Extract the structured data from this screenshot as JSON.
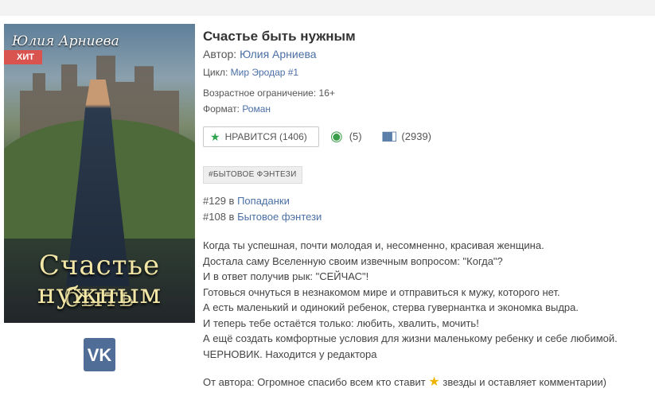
{
  "cover": {
    "author_script": "Юлия Арниева",
    "badge": "ХИТ",
    "title_line1": "Счастье быть",
    "title_line2": "нужным"
  },
  "social": {
    "vk_label": "VK"
  },
  "book": {
    "title": "Счастье быть нужным",
    "author_label": "Автор:",
    "author_name": "Юлия Арниева",
    "cycle_label": "Цикл:",
    "cycle_name": "Мир Эродар #1",
    "age_label": "Возрастное ограничение:",
    "age_value": "16+",
    "format_label": "Формат:",
    "format_value": "Роман"
  },
  "actions": {
    "like_label": "НРАВИТСЯ (1406)",
    "piggy_count": "(5)",
    "library_count": "(2939)"
  },
  "tags": [
    "#БЫТОВОЕ ФЭНТЕЗИ"
  ],
  "ratings": [
    {
      "place": "#129",
      "prep": "в",
      "genre": "Попаданки"
    },
    {
      "place": "#108",
      "prep": "в",
      "genre": "Бытовое фэнтези"
    }
  ],
  "annotation": [
    "Когда ты успешная, почти молодая и, несомненно, красивая женщина.",
    "Достала саму Вселенную своим извечным вопросом: \"Когда\"?",
    "И в ответ получив рык: \"СЕЙЧАС\"!",
    "Готовься очнуться в незнакомом мире и отправиться к мужу, которого нет.",
    "А есть маленький и одинокий ребенок, стерва гувернантка и экономка выдра.",
    "И теперь тебе остаётся только: любить, хвалить, мочить!",
    "А ещё создать комфортные условия для жизни маленькому ребенку и себе любимой.",
    "ЧЕРНОВИК. Находится у редактора"
  ],
  "from_author": {
    "before": "От автора: Огромное спасибо всем кто ставит",
    "after": "звезды и оставляет комментарии)"
  }
}
